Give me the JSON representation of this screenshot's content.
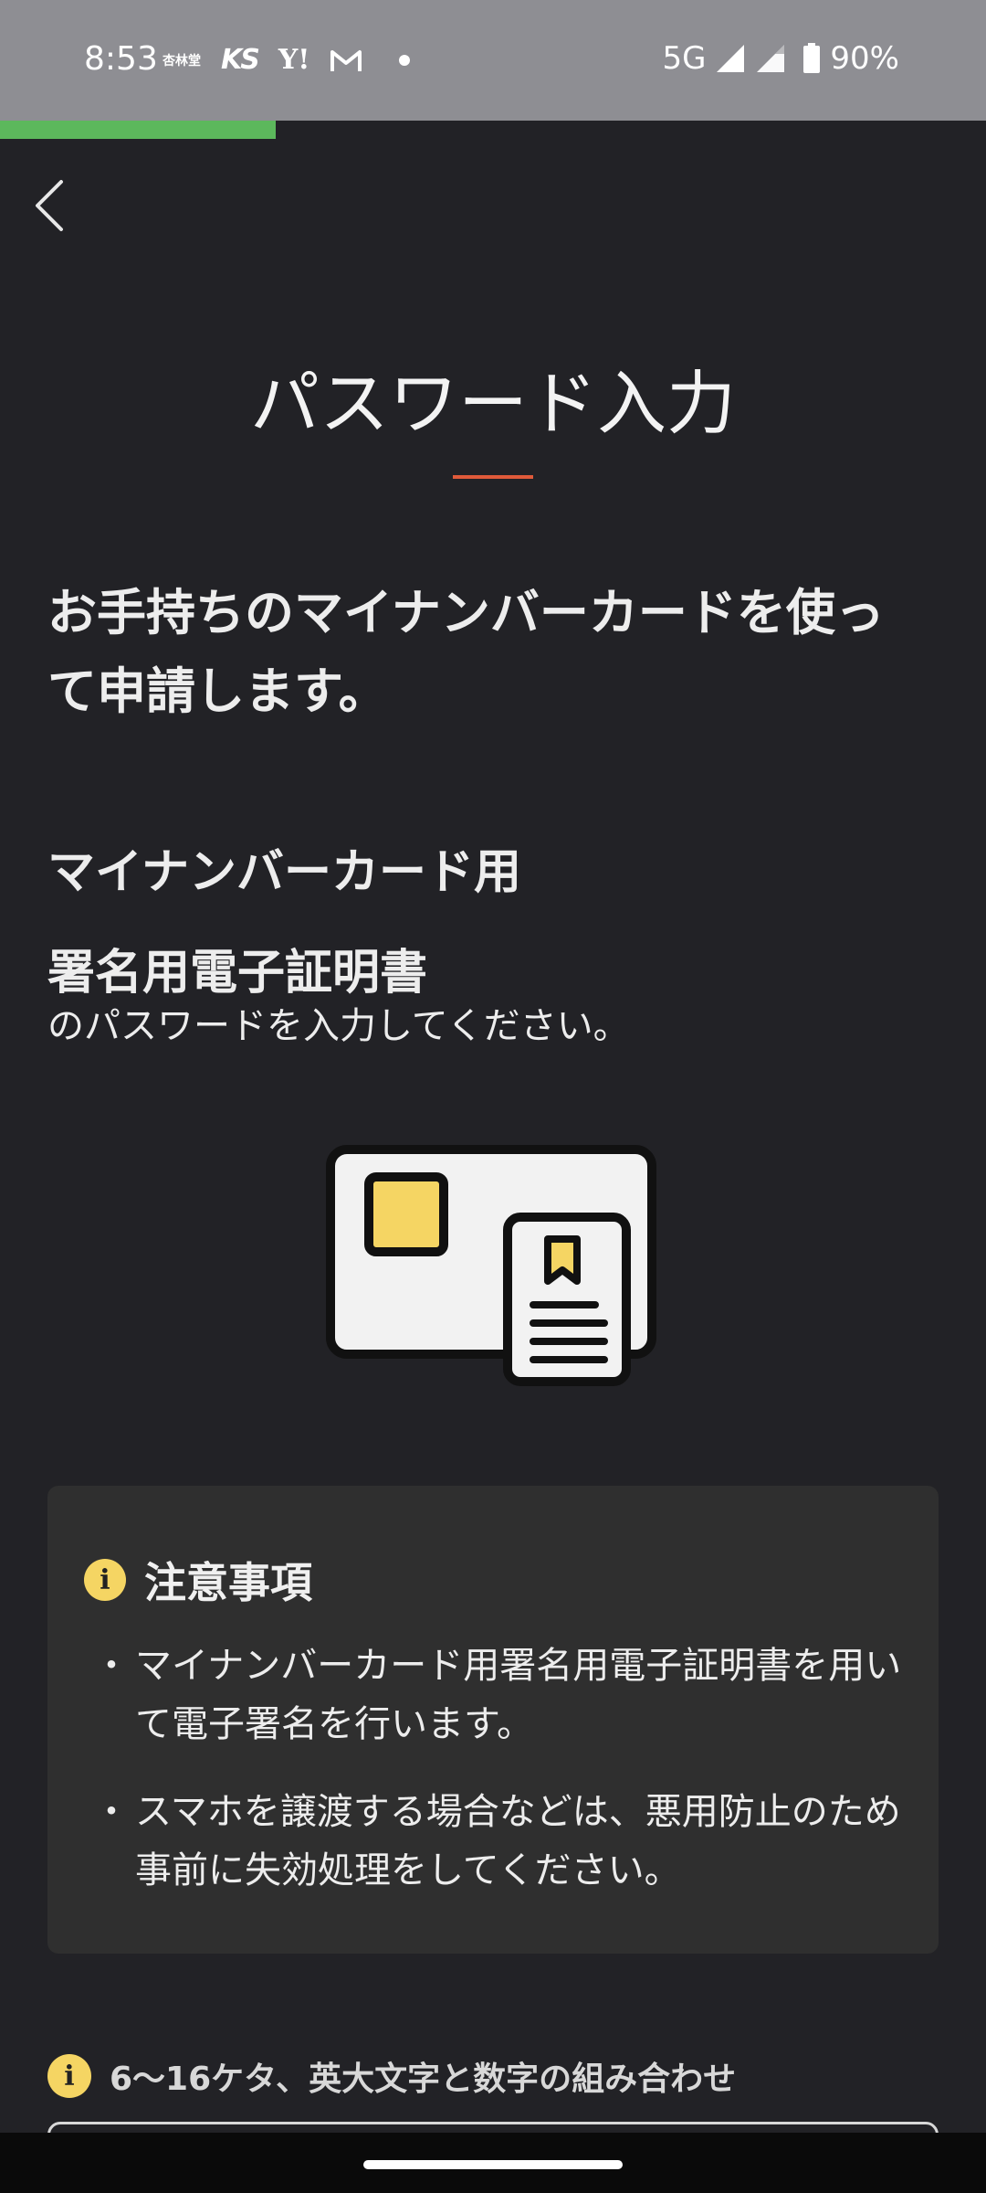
{
  "status_bar": {
    "time": "8:53",
    "app_icons": {
      "kyorin": "杏林堂",
      "ks": "KS",
      "yahoo": "Y!",
      "gmail": "gmail-icon"
    },
    "network": "5G",
    "battery_percent": "90%",
    "background_color": "#8e8e93"
  },
  "progress": {
    "fraction": 0.28,
    "color": "#5cb85c"
  },
  "header": {
    "back_icon": "chevron-left-icon"
  },
  "page": {
    "title": "パスワード入力",
    "accent_color": "#e05a3a",
    "lead_text": "お手持ちのマイナンバーカードを使って申請します。",
    "subhead_line1": "マイナンバーカード用",
    "subhead_line2": "署名用電子証明書",
    "subtext": "のパスワードを入力してください。"
  },
  "illustration": {
    "icon": "my-number-card-icon",
    "chip_color": "#f5d563"
  },
  "notice": {
    "title": "注意事項",
    "icon": "info-icon",
    "items": [
      "マイナンバーカード用署名用電子証明書を用いて電子署名を行います。",
      "スマホを譲渡する場合などは、悪用防止のため事前に失効処理をしてください。"
    ]
  },
  "password_rule": {
    "text": "6〜16ケタ、英大文字と数字の組み合わせ",
    "icon": "info-icon"
  },
  "password_field": {
    "value": ""
  }
}
